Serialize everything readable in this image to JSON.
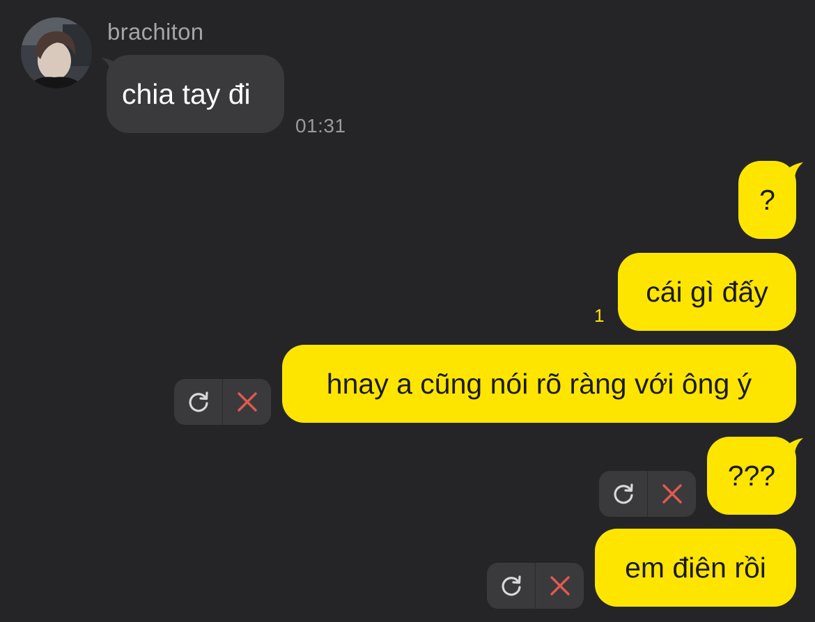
{
  "sender": {
    "name": "brachiton"
  },
  "incoming": [
    {
      "text": "chia tay đi",
      "time": "01:31"
    }
  ],
  "outgoing": [
    {
      "text": "?"
    },
    {
      "text": "cái gì đấy",
      "unread": "1"
    },
    {
      "text": "hnay a cũng nói rõ ràng với ông ý"
    },
    {
      "text": "???"
    },
    {
      "text": "em điên rồi"
    }
  ],
  "icons": {
    "retry": "retry-icon",
    "delete": "delete-icon"
  },
  "colors": {
    "background": "#252527",
    "incoming_bubble": "#3a3a3c",
    "outgoing_bubble": "#fee500",
    "delete_icon": "#e05a4f",
    "retry_icon": "#d8d8d8"
  }
}
